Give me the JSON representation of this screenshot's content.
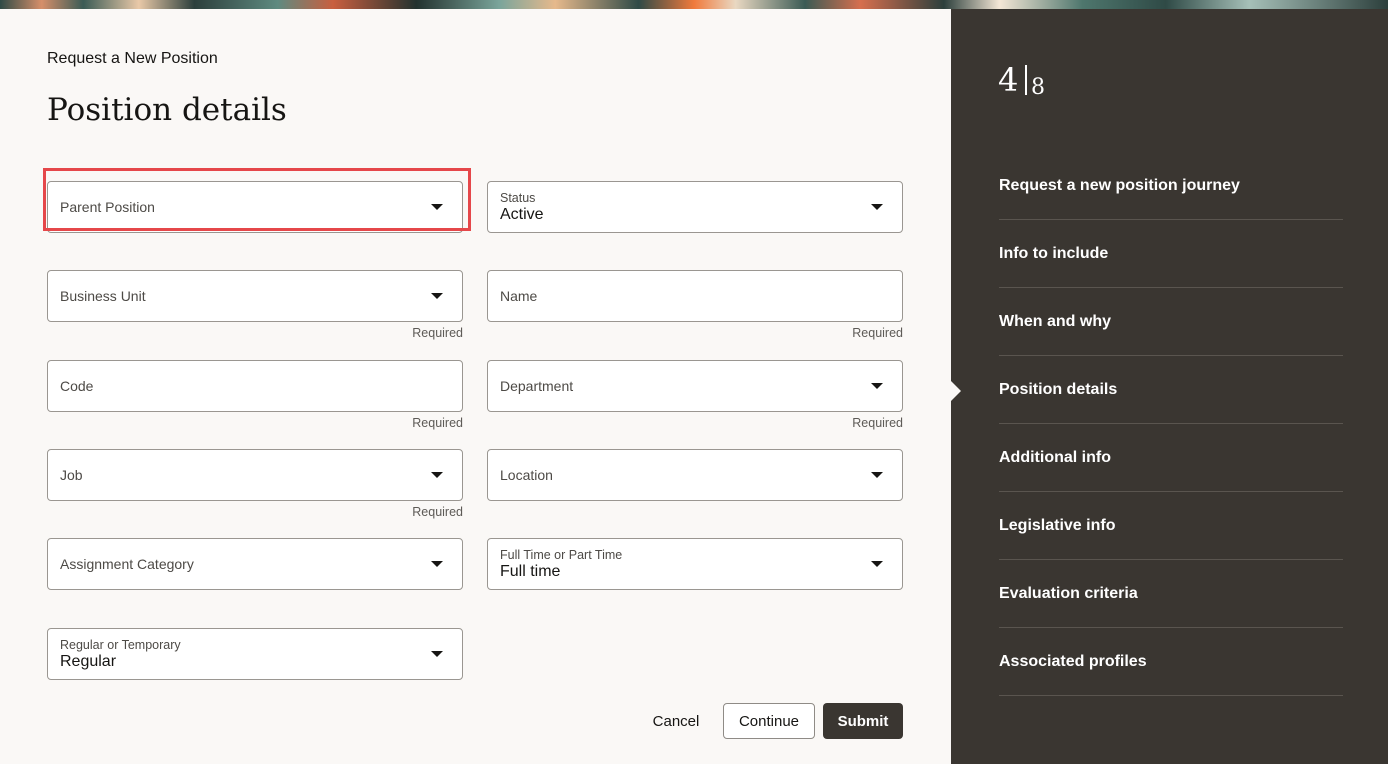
{
  "header": {
    "pre_title": "Request a New Position",
    "title": "Position details"
  },
  "form": {
    "parent_position": {
      "label": "Parent Position"
    },
    "status": {
      "label": "Status",
      "value": "Active"
    },
    "business_unit": {
      "label": "Business Unit",
      "hint": "Required"
    },
    "name": {
      "label": "Name",
      "hint": "Required"
    },
    "code": {
      "label": "Code",
      "hint": "Required"
    },
    "department": {
      "label": "Department",
      "hint": "Required"
    },
    "job": {
      "label": "Job",
      "hint": "Required"
    },
    "location": {
      "label": "Location"
    },
    "assignment_category": {
      "label": "Assignment Category"
    },
    "full_part_time": {
      "label": "Full Time or Part Time",
      "value": "Full time"
    },
    "regular_temporary": {
      "label": "Regular or Temporary",
      "value": "Regular"
    }
  },
  "actions": {
    "cancel": "Cancel",
    "continue": "Continue",
    "submit": "Submit"
  },
  "sidebar": {
    "current_step": "4",
    "total_steps": "8",
    "items": [
      {
        "label": "Request a new position journey"
      },
      {
        "label": "Info to include"
      },
      {
        "label": "When and why"
      },
      {
        "label": "Position details"
      },
      {
        "label": "Additional info"
      },
      {
        "label": "Legislative info"
      },
      {
        "label": "Evaluation criteria"
      },
      {
        "label": "Associated profiles"
      }
    ]
  },
  "colors": {
    "sidebar_bg": "#3a3631",
    "page_bg": "#faf8f6",
    "highlight": "#e5474a"
  }
}
